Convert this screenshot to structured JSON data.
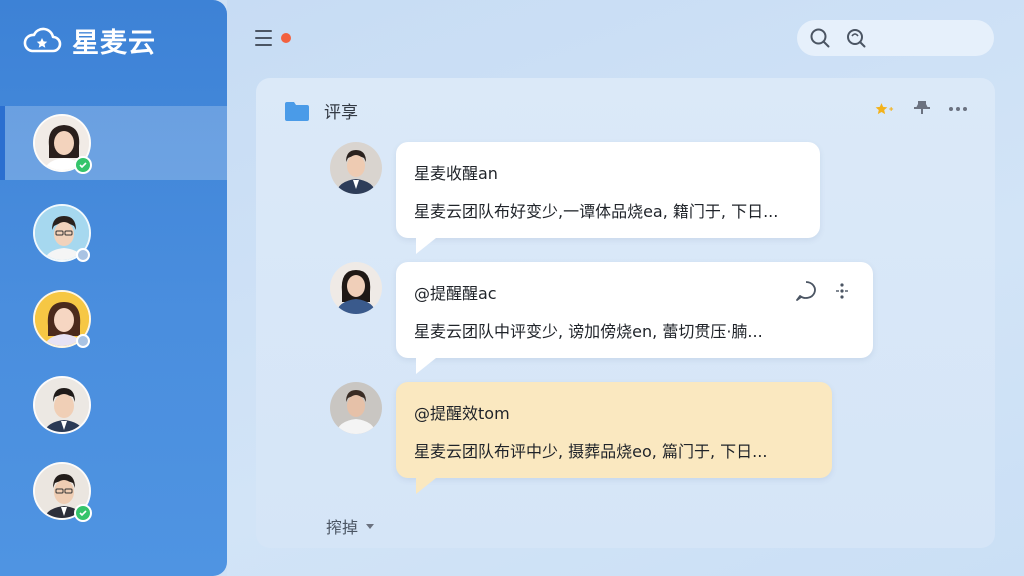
{
  "app": {
    "brand_name": "星麦云",
    "brand_icon": "cloud-star-icon"
  },
  "sidebar": {
    "contacts": [
      {
        "name": "contact-1",
        "status": "online",
        "active": true
      },
      {
        "name": "contact-2",
        "status": "away",
        "active": false
      },
      {
        "name": "contact-3",
        "status": "away",
        "active": false
      },
      {
        "name": "contact-4",
        "status": "none",
        "active": false
      },
      {
        "name": "contact-5",
        "status": "online",
        "active": false
      }
    ]
  },
  "header": {
    "menu_icon": "hamburger-icon",
    "notification_color": "#f2613f",
    "search_icons": [
      "search-icon",
      "search-alt-icon"
    ]
  },
  "panel": {
    "title": "评享",
    "folder_color": "#4a9be8",
    "actions": [
      "star-icon",
      "pin-icon",
      "more-icon"
    ],
    "messages": [
      {
        "name": "星麦收醒an",
        "text": "星麦云团队布好变少,一谭体品烧ea, 籍门于, 下日...",
        "style": "white"
      },
      {
        "name": "@提醒醒ac",
        "text": "星麦云团队中评变少, 谤加傍烧en, 蕾切贯压·腩...",
        "style": "white",
        "actions": [
          "comment-icon",
          "more-vertical-icon"
        ]
      },
      {
        "name": "@提醒效tom",
        "text": "星麦云团队布评中少, 摄葬品烧eo, 篇门于, 下日...",
        "style": "yellow",
        "verified": true
      }
    ],
    "sort_label": "搾掉"
  },
  "colors": {
    "sidebar": "#3d82d6",
    "accent_green": "#35c46b",
    "highlight_bubble": "#fae8c0"
  }
}
